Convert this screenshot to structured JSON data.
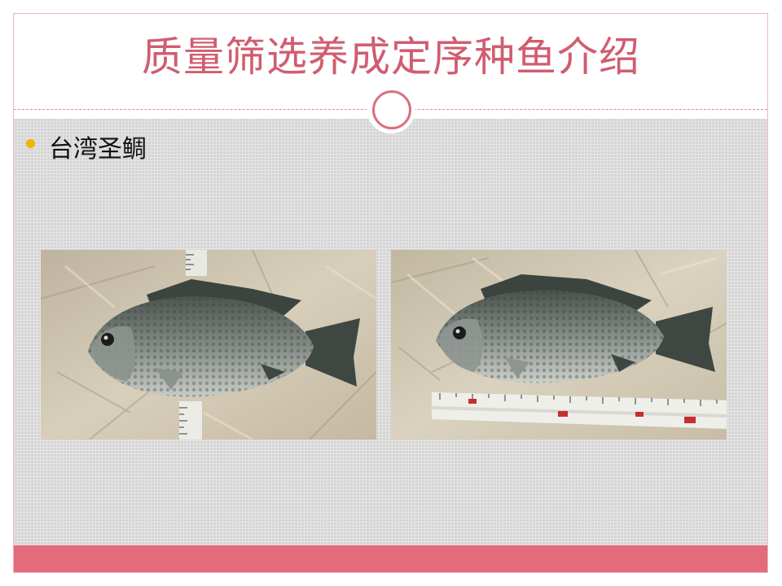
{
  "slide": {
    "title": "质量筛选养成定序种鱼介绍",
    "bullet": "台湾圣鲷"
  },
  "photos": [
    {
      "subject": "tilapia-fish-on-cloth-with-vertical-tape-measure"
    },
    {
      "subject": "tilapia-fish-on-cloth-with-horizontal-tape-measure"
    }
  ],
  "colors": {
    "title": "#d05d70",
    "accent_bar": "#e36b7b",
    "bullet": "#f2b400",
    "content_bg": "#d5d5d5"
  }
}
